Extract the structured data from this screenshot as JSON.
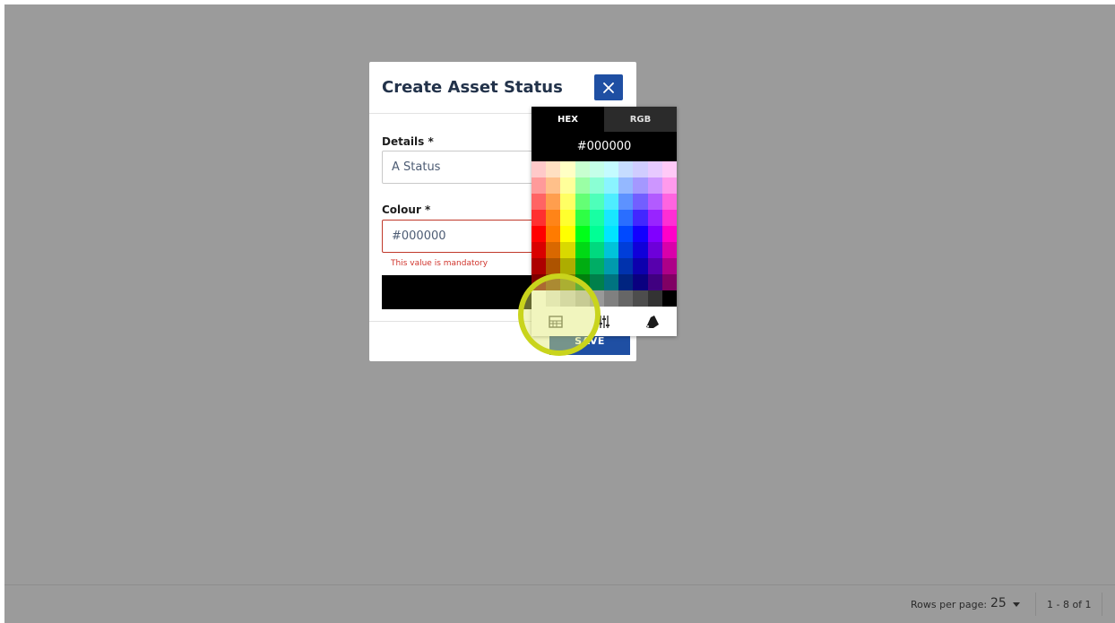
{
  "dialog": {
    "title": "Create Asset Status",
    "details_label": "Details *",
    "details_value": "A Status",
    "colour_label": "Colour *",
    "colour_value": "#000000",
    "error_message": "This value is mandatory",
    "save_label": "SAVE",
    "close_icon": "close-icon"
  },
  "color_picker": {
    "tabs": [
      "HEX",
      "RGB"
    ],
    "active_tab": "HEX",
    "hex_value": "#000000",
    "mode_icons": [
      "swatches-icon",
      "sliders-icon",
      "palette-icon"
    ],
    "grid_colors": [
      [
        "#ffc9c9",
        "#ffe0c2",
        "#ffffc4",
        "#c8ffd0",
        "#c4ffe9",
        "#c4fbff",
        "#c6dcff",
        "#d0ccff",
        "#e7c9ff",
        "#ffc9f7"
      ],
      [
        "#ff9a9a",
        "#ffc08a",
        "#ffff9a",
        "#9affa5",
        "#8affd4",
        "#8af4ff",
        "#94b8ff",
        "#a498ff",
        "#cd96ff",
        "#ff9aec"
      ],
      [
        "#ff6464",
        "#ff9e4e",
        "#ffff64",
        "#64ff75",
        "#4effba",
        "#4eedff",
        "#5d92ff",
        "#725fff",
        "#b25bff",
        "#ff64e0"
      ],
      [
        "#ff3030",
        "#ff8418",
        "#ffff2e",
        "#2eff45",
        "#18ffa3",
        "#18e7ff",
        "#2a6eff",
        "#4227ff",
        "#9824ff",
        "#ff2ed4"
      ],
      [
        "#ff0000",
        "#ff7b00",
        "#ffff00",
        "#00ff19",
        "#00ff95",
        "#00e5ff",
        "#0049ff",
        "#1300ff",
        "#8000ff",
        "#ff00c8"
      ],
      [
        "#d90000",
        "#d96800",
        "#d9d900",
        "#00d915",
        "#00d97f",
        "#00c3d9",
        "#003ed9",
        "#1000d9",
        "#6d00d9",
        "#d900aa"
      ],
      [
        "#ad0000",
        "#ad5300",
        "#adad00",
        "#00ad11",
        "#00ad65",
        "#009bad",
        "#0032ad",
        "#0d00ad",
        "#5700ad",
        "#ad0088"
      ],
      [
        "#800000",
        "#803d00",
        "#808000",
        "#00800d",
        "#00804b",
        "#007380",
        "#002480",
        "#0a0080",
        "#400080",
        "#800064"
      ],
      [
        "#ffffff",
        "#e6e6e6",
        "#cccccc",
        "#b3b3b3",
        "#999999",
        "#808080",
        "#666666",
        "#4d4d4d",
        "#333333",
        "#000000"
      ]
    ]
  },
  "footer": {
    "rows_per_page_label": "Rows per page:",
    "rows_per_page_value": "25",
    "range_text": "1 - 8 of 1"
  }
}
